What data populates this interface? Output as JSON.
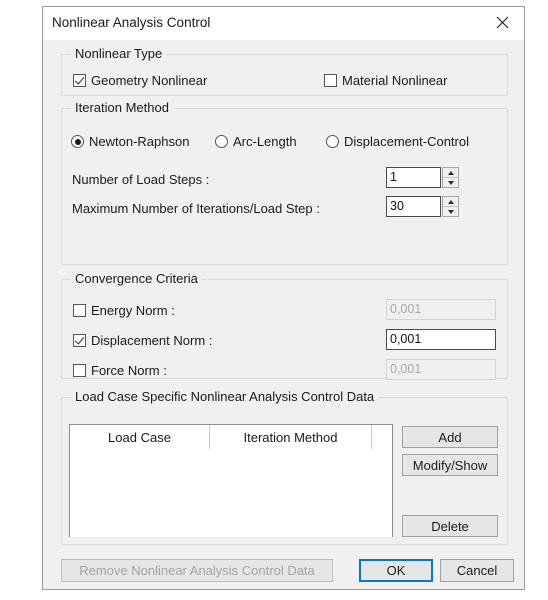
{
  "dialog": {
    "title": "Nonlinear Analysis Control",
    "close_icon": "close-icon"
  },
  "nonlinear_type": {
    "legend": "Nonlinear Type",
    "options": [
      {
        "label": "Geometry Nonlinear",
        "checked": true
      },
      {
        "label": "Material Nonlinear",
        "checked": false
      }
    ]
  },
  "iteration_method": {
    "legend": "Iteration Method",
    "options": [
      {
        "label": "Newton-Raphson",
        "selected": true
      },
      {
        "label": "Arc-Length",
        "selected": false
      },
      {
        "label": "Displacement-Control",
        "selected": false
      }
    ],
    "load_steps": {
      "label": "Number of Load Steps :",
      "value": "1"
    },
    "max_iterations": {
      "label": "Maximum Number of Iterations/Load Step :",
      "value": "30"
    }
  },
  "convergence": {
    "legend": "Convergence Criteria",
    "rows": [
      {
        "label": "Energy Norm :",
        "checked": false,
        "value": "0,001",
        "enabled": false
      },
      {
        "label": "Displacement Norm :",
        "checked": true,
        "value": "0,001",
        "enabled": true
      },
      {
        "label": "Force Norm :",
        "checked": false,
        "value": "0,001",
        "enabled": false
      }
    ]
  },
  "load_case_section": {
    "legend": "Load Case Specific Nonlinear Analysis Control Data",
    "columns": [
      "Load Case",
      "Iteration Method"
    ],
    "rows": [],
    "buttons": {
      "add": "Add",
      "modify_show": "Modify/Show",
      "delete": "Delete"
    }
  },
  "footer": {
    "remove": "Remove Nonlinear Analysis Control Data",
    "remove_enabled": false,
    "ok": "OK",
    "cancel": "Cancel"
  },
  "colors": {
    "accent": "#0078d7",
    "dialog_bg": "#f0f0f0",
    "disabled_text": "#a3a3a3"
  }
}
